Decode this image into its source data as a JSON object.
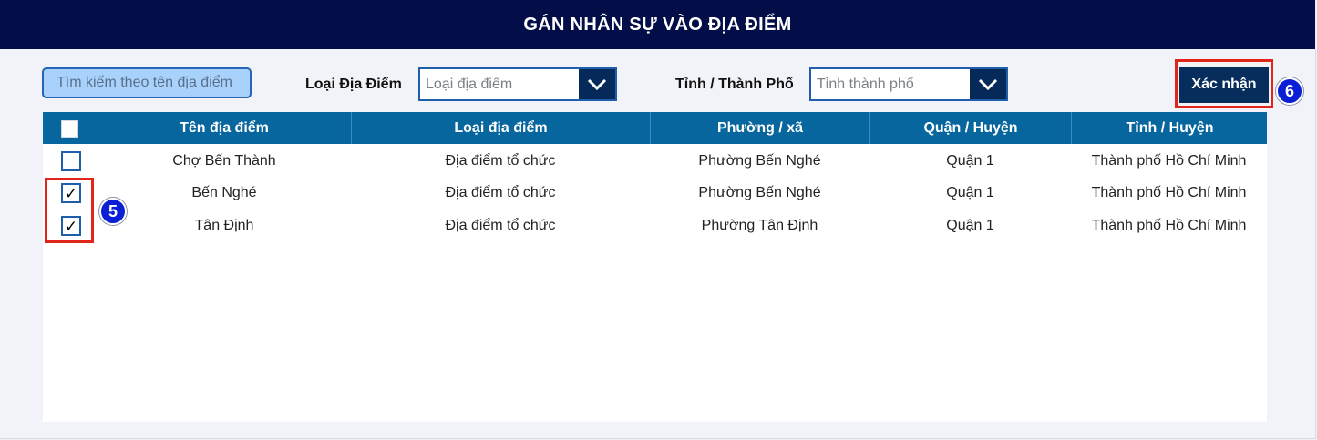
{
  "header": {
    "title": "GÁN NHÂN SỰ VÀO ĐỊA ĐIỂM"
  },
  "filters": {
    "search_placeholder": "Tìm kiếm theo tên địa điểm",
    "location_type_label": "Loại Địa Điểm",
    "location_type_value": "Loại địa điểm",
    "province_label": "Tỉnh / Thành Phố",
    "province_value": "Tỉnh thành phố"
  },
  "actions": {
    "confirm_label": "Xác nhận"
  },
  "annotations": {
    "badge_5": "5",
    "badge_6": "6"
  },
  "table": {
    "columns": [
      "Tên địa điểm",
      "Loại địa điểm",
      "Phường / xã",
      "Quận / Huyện",
      "Tỉnh / Huyện"
    ],
    "select_all_checked": false,
    "rows": [
      {
        "checked": false,
        "check_mark": "",
        "cells": [
          "Chợ Bến Thành",
          "Địa điểm tổ chức",
          "Phường Bến Nghé",
          "Quận 1",
          "Thành phố Hồ Chí Minh"
        ]
      },
      {
        "checked": true,
        "check_mark": "✓",
        "cells": [
          "Bến Nghé",
          "Địa điểm tổ chức",
          "Phường Bến Nghé",
          "Quận 1",
          "Thành phố Hồ Chí Minh"
        ]
      },
      {
        "checked": true,
        "check_mark": "✓",
        "cells": [
          "Tân Định",
          "Địa điểm tổ chức",
          "Phường Tân Định",
          "Quận 1",
          "Thành phố Hồ Chí Minh"
        ]
      }
    ]
  },
  "colors": {
    "title_bar": "#030e49",
    "table_header": "#07669e",
    "button": "#062d5c",
    "highlight": "#e1251b",
    "badge": "#0b1fd6"
  },
  "icons": {
    "dropdown": "chevron-down-icon",
    "check": "checkmark-icon"
  }
}
